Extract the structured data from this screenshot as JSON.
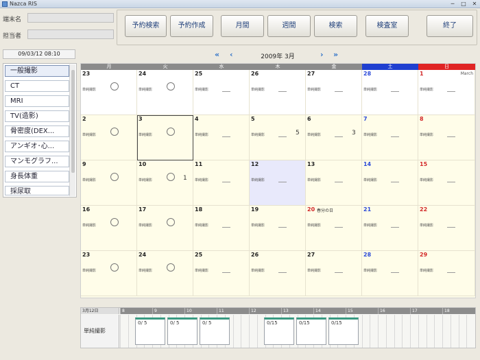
{
  "window": {
    "title": "Nazca RIS",
    "minimize": "─",
    "maximize": "□",
    "close": "✕"
  },
  "header": {
    "terminal_label": "端末名",
    "staff_label": "担当者"
  },
  "toolbar": [
    {
      "id": "reserve-search",
      "label": "予約検索"
    },
    {
      "id": "reserve-create",
      "label": "予約作成"
    },
    {
      "id": "month-view",
      "label": "月間"
    },
    {
      "id": "week-view",
      "label": "週間"
    },
    {
      "id": "search",
      "label": "検索"
    },
    {
      "id": "exam-room",
      "label": "検査室"
    },
    {
      "id": "exit",
      "label": "終了"
    }
  ],
  "datetime": "09/03/12 08:10",
  "modalities": [
    {
      "label": "一般撮影",
      "selected": true
    },
    {
      "label": "CT",
      "selected": false
    },
    {
      "label": "MRI",
      "selected": false
    },
    {
      "label": "TV(造影)",
      "selected": false
    },
    {
      "label": "骨密度(DEX...",
      "selected": false
    },
    {
      "label": "アンギオ･心...",
      "selected": false
    },
    {
      "label": "マンモグラフ...",
      "selected": false
    },
    {
      "label": "身長体重",
      "selected": false
    },
    {
      "label": "採尿取",
      "selected": false
    }
  ],
  "nav": {
    "prev_year": "«",
    "prev_month": "‹",
    "next_month": "›",
    "next_year": "»",
    "month_title": "2009年 3月"
  },
  "calendar": {
    "weekdays": [
      "月",
      "火",
      "水",
      "木",
      "金",
      "土",
      "日"
    ],
    "slot_label": "単純撮影",
    "month_label": "March",
    "holiday_label": "春分の日",
    "weeks": [
      [
        {
          "d": "23",
          "m": "circle",
          "bg": "white"
        },
        {
          "d": "24",
          "m": "circle",
          "bg": "white"
        },
        {
          "d": "25",
          "m": "dash",
          "bg": "white"
        },
        {
          "d": "26",
          "m": "dash",
          "bg": "white"
        },
        {
          "d": "27",
          "m": "dash",
          "bg": "white"
        },
        {
          "d": "28",
          "m": "dash",
          "bg": "white"
        },
        {
          "d": "1",
          "m": "dash",
          "bg": "white",
          "month_start": true
        }
      ],
      [
        {
          "d": "2",
          "m": "circle"
        },
        {
          "d": "3",
          "m": "circle",
          "framed": true
        },
        {
          "d": "4",
          "m": "dash"
        },
        {
          "d": "5",
          "m": "dash",
          "count": "5"
        },
        {
          "d": "6",
          "m": "dash",
          "count": "3"
        },
        {
          "d": "7",
          "m": "dash"
        },
        {
          "d": "8",
          "m": "dash"
        }
      ],
      [
        {
          "d": "9",
          "m": "circle"
        },
        {
          "d": "10",
          "m": "circle",
          "count": "1"
        },
        {
          "d": "11",
          "m": "dash"
        },
        {
          "d": "12",
          "m": "dash",
          "bg": "lav"
        },
        {
          "d": "13",
          "m": "dash"
        },
        {
          "d": "14",
          "m": "dash"
        },
        {
          "d": "15",
          "m": "dash"
        }
      ],
      [
        {
          "d": "16",
          "m": "circle"
        },
        {
          "d": "17",
          "m": "circle"
        },
        {
          "d": "18",
          "m": "dash"
        },
        {
          "d": "19",
          "m": "dash"
        },
        {
          "d": "20",
          "m": "dash",
          "holiday": true
        },
        {
          "d": "21",
          "m": "dash"
        },
        {
          "d": "22",
          "m": "dash"
        }
      ],
      [
        {
          "d": "23",
          "m": "circle"
        },
        {
          "d": "24",
          "m": "circle"
        },
        {
          "d": "25",
          "m": "dash"
        },
        {
          "d": "26",
          "m": "dash"
        },
        {
          "d": "27",
          "m": "dash"
        },
        {
          "d": "28",
          "m": "dash"
        },
        {
          "d": "29",
          "m": "dash"
        }
      ]
    ]
  },
  "timeline": {
    "head_label": "3月12日",
    "row_label": "単純撮影",
    "hours": [
      "8",
      "9",
      "10",
      "11",
      "12",
      "13",
      "14",
      "15",
      "16",
      "17",
      "18"
    ],
    "slots": [
      {
        "label": "0/ 5",
        "hour_index": 0
      },
      {
        "label": "0/ 5",
        "hour_index": 1
      },
      {
        "label": "0/ 5",
        "hour_index": 2
      },
      {
        "label": "0/15",
        "hour_index": 4
      },
      {
        "label": "0/15",
        "hour_index": 5
      },
      {
        "label": "0/15",
        "hour_index": 6
      }
    ]
  },
  "colors": {
    "saturday": "#1f3fd0",
    "sunday": "#e02424",
    "slot_accent": "#3a9a82",
    "nav_accent": "#2a6fc7"
  }
}
